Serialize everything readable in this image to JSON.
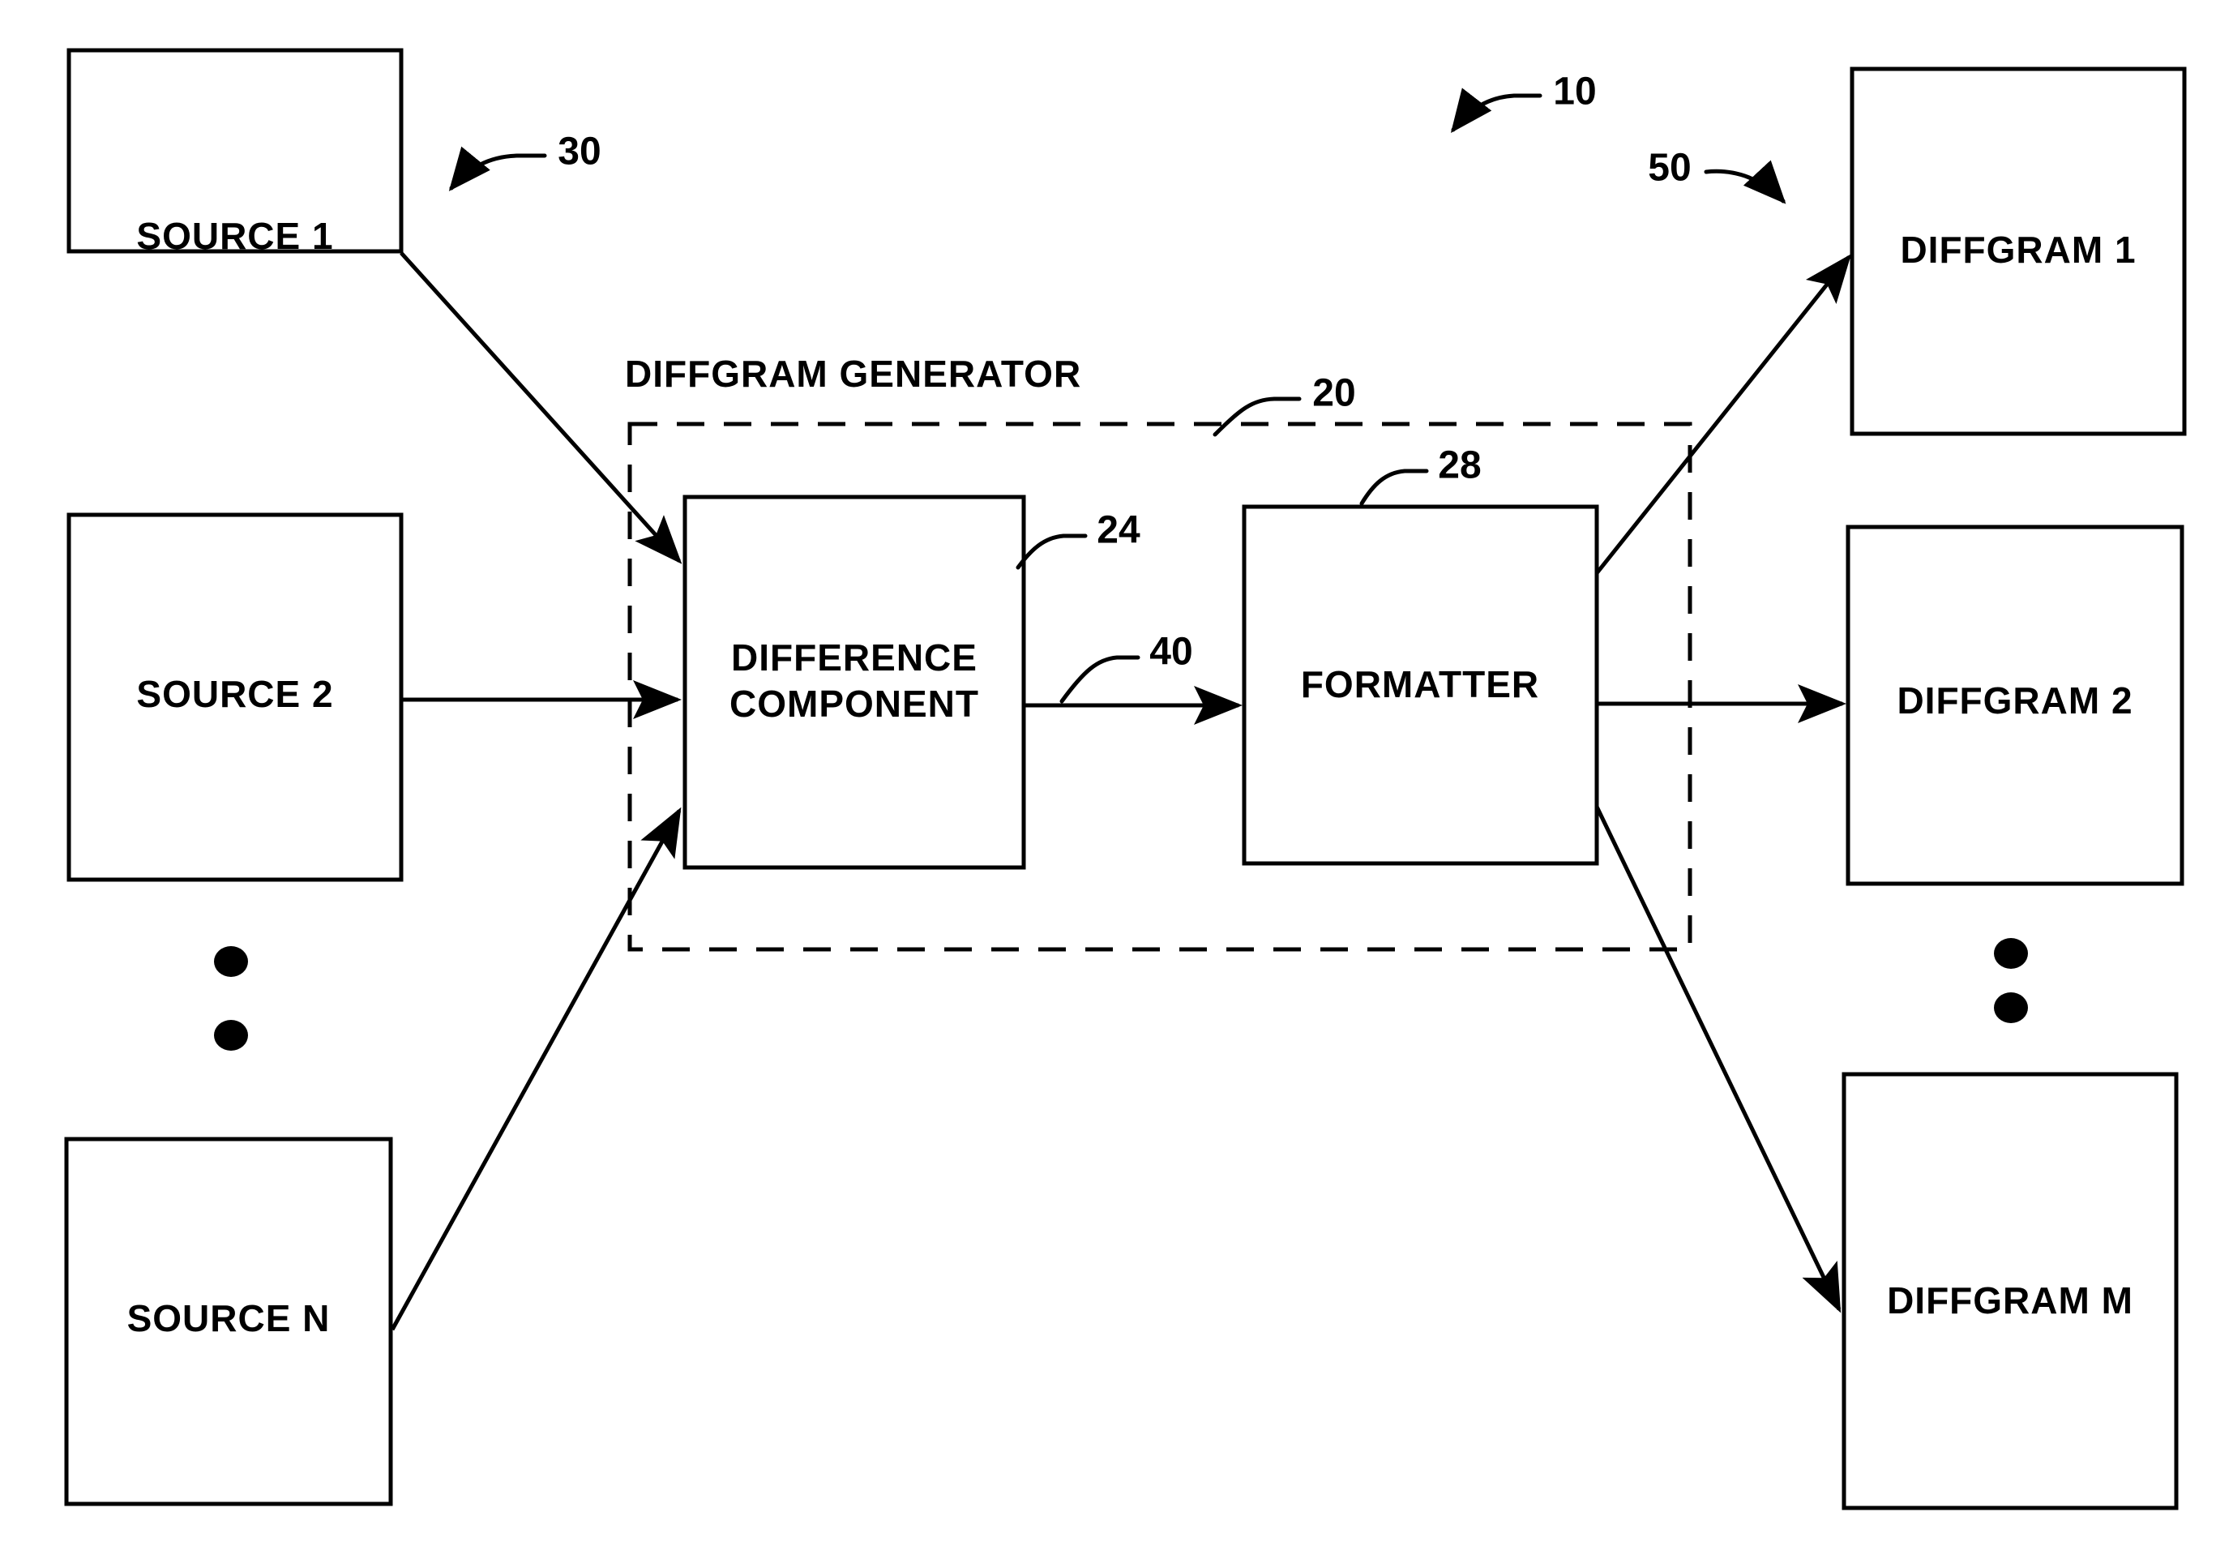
{
  "figure": {
    "group_title": "DIFFGRAM GENERATOR",
    "sources": [
      {
        "label": "SOURCE 1"
      },
      {
        "label": "SOURCE 2"
      },
      {
        "label": "SOURCE N"
      }
    ],
    "processors": [
      {
        "label": "DIFFERENCE COMPONENT",
        "line1": "DIFFERENCE",
        "line2": "COMPONENT"
      },
      {
        "label": "FORMATTER",
        "line1": "FORMATTER",
        "line2": ""
      }
    ],
    "outputs": [
      {
        "label": "DIFFGRAM 1"
      },
      {
        "label": "DIFFGRAM 2"
      },
      {
        "label": "DIFFGRAM M"
      }
    ],
    "reference_numerals": [
      {
        "id": "10",
        "value": "10"
      },
      {
        "id": "20",
        "value": "20"
      },
      {
        "id": "24",
        "value": "24"
      },
      {
        "id": "28",
        "value": "28"
      },
      {
        "id": "30",
        "value": "30"
      },
      {
        "id": "40",
        "value": "40"
      },
      {
        "id": "50",
        "value": "50"
      }
    ],
    "colors": {
      "ink": "#000000",
      "paper": "#ffffff"
    }
  }
}
